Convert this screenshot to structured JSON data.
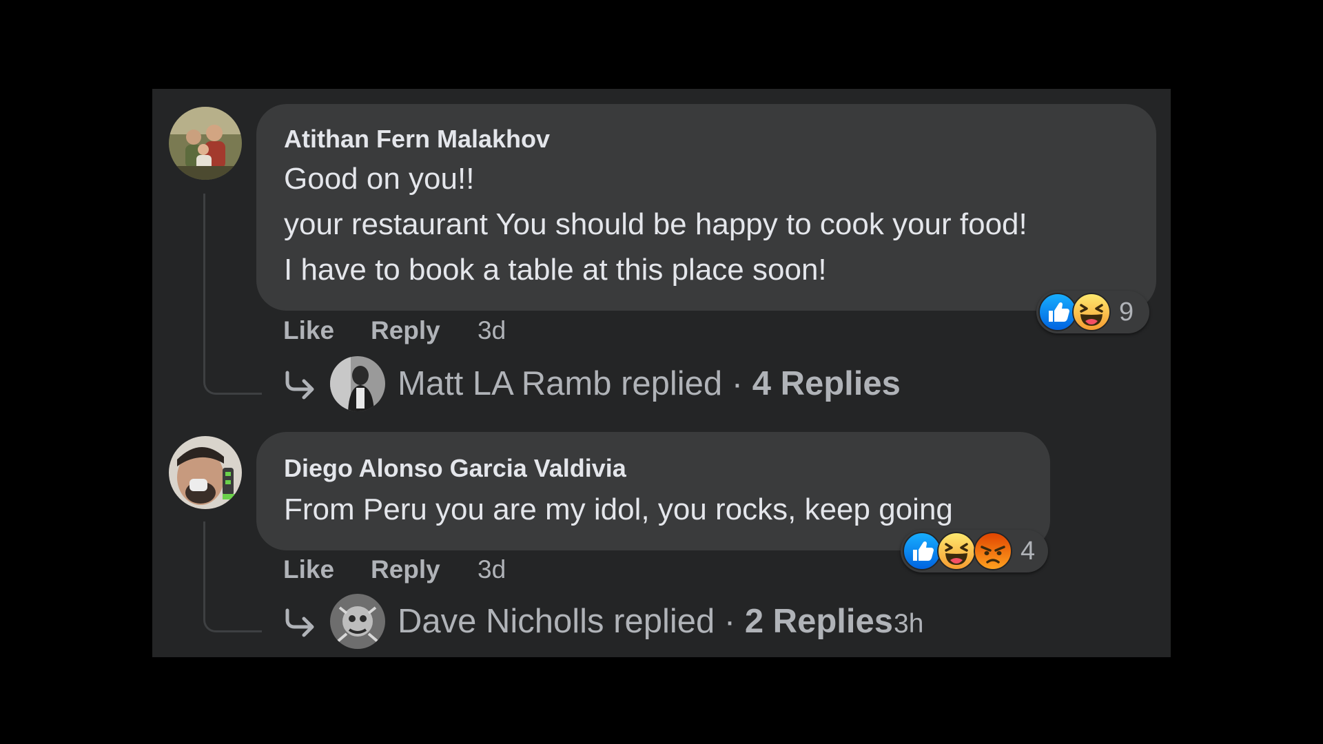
{
  "comments": [
    {
      "author": "Atithan Fern Malakhov",
      "lines": [
        "Good on you!!",
        "your restaurant You should be happy to cook your food!",
        "I have to book a table at this place soon!"
      ],
      "actions": {
        "like": "Like",
        "reply": "Reply",
        "time": "3d"
      },
      "reactions": {
        "icons": [
          "like-icon",
          "haha-icon"
        ],
        "count": "9"
      },
      "replies": {
        "who": "Matt LA Ramb replied",
        "separator": " · ",
        "count": "4 Replies",
        "time": ""
      }
    },
    {
      "author": "Diego Alonso Garcia Valdivia",
      "lines": [
        "From Peru you are my idol, you rocks, keep going"
      ],
      "actions": {
        "like": "Like",
        "reply": "Reply",
        "time": "3d"
      },
      "reactions": {
        "icons": [
          "like-icon",
          "haha-icon",
          "angry-icon"
        ],
        "count": "4"
      },
      "replies": {
        "who": "Dave Nicholls replied",
        "separator": " · ",
        "count": "2 Replies",
        "time": "3h"
      }
    }
  ],
  "colors": {
    "panel": "#242526",
    "bubble": "#3a3b3c",
    "text_primary": "#e4e6eb",
    "text_secondary": "#b0b3b8",
    "like_blue": "#1877f2",
    "haha_yellow": "#f7b125",
    "angry_orange": "#e9710f"
  }
}
